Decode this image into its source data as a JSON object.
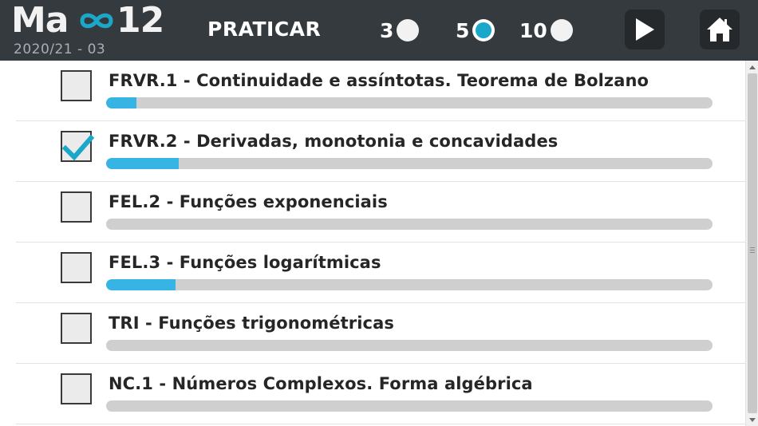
{
  "app": {
    "logo_prefix": "Ma",
    "logo_suffix": "12",
    "school_year": "2020/21 - 03"
  },
  "header": {
    "mode_label": "PRATICAR",
    "question_counts": [
      {
        "label": "3",
        "selected": false
      },
      {
        "label": "5",
        "selected": true
      },
      {
        "label": "10",
        "selected": false
      }
    ],
    "play_icon": "play-icon",
    "home_icon": "home-icon"
  },
  "colors": {
    "header_bg": "#353a3e",
    "accent": "#1aa7c9",
    "progress_fill": "#36b5e5",
    "progress_track": "#cfcfcf"
  },
  "topics": [
    {
      "label": "FRVR.1 - Continuidade e assíntotas. Teorema de Bolzano",
      "checked": false,
      "progress": 0.05
    },
    {
      "label": "FRVR.2 - Derivadas, monotonia e concavidades",
      "checked": true,
      "progress": 0.12
    },
    {
      "label": "FEL.2 - Funções exponenciais",
      "checked": false,
      "progress": 0.0
    },
    {
      "label": "FEL.3 - Funções logarítmicas",
      "checked": false,
      "progress": 0.115
    },
    {
      "label": "TRI - Funções trigonométricas",
      "checked": false,
      "progress": 0.0
    },
    {
      "label": "NC.1 - Números Complexos. Forma algébrica",
      "checked": false,
      "progress": 0.0
    }
  ]
}
